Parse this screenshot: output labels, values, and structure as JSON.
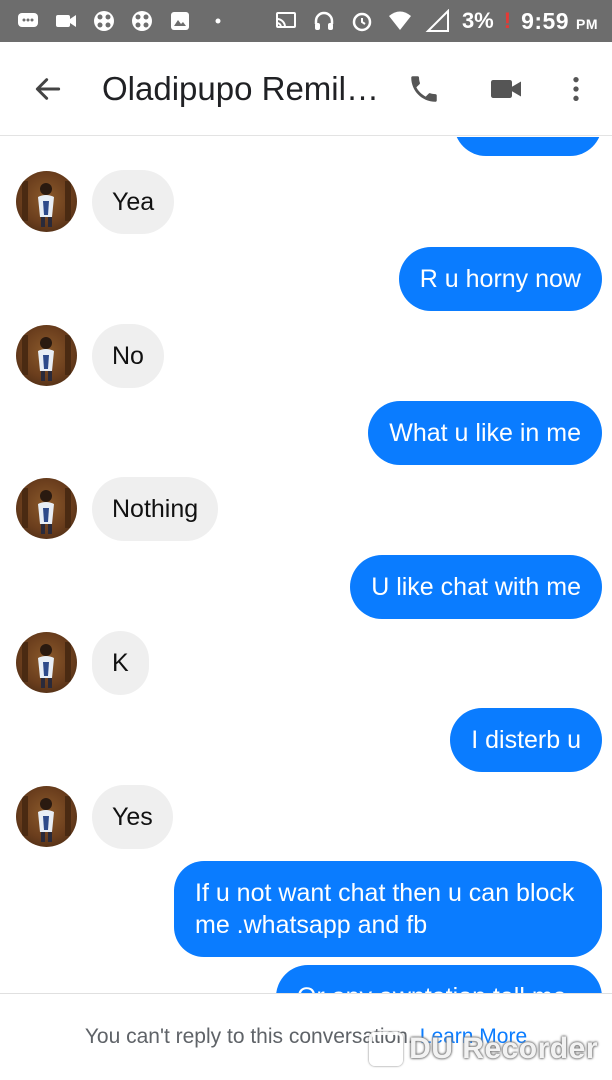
{
  "status_bar": {
    "battery": "3%",
    "battery_warning": "!",
    "time": "9:59",
    "ampm": "PM",
    "left_icons": [
      "chat-icon",
      "video-icon",
      "app-icon",
      "app-icon",
      "image-icon",
      "dot-icon"
    ],
    "right_icons": [
      "cast-icon",
      "headset-icon",
      "alarm-icon",
      "wifi-icon",
      "signal-icon"
    ]
  },
  "toolbar": {
    "title": "Oladipupo Remil…",
    "back_icon": "back-arrow-icon",
    "call_icon": "phone-icon",
    "video_icon": "video-camera-icon",
    "more_icon": "more-vert-icon"
  },
  "messages": [
    {
      "id": "m0",
      "dir": "out",
      "text": ""
    },
    {
      "id": "m1",
      "dir": "in",
      "text": "Yea"
    },
    {
      "id": "m2",
      "dir": "out",
      "text": "R u horny now"
    },
    {
      "id": "m3",
      "dir": "in",
      "text": "No"
    },
    {
      "id": "m4",
      "dir": "out",
      "text": "What u like in me"
    },
    {
      "id": "m5",
      "dir": "in",
      "text": "Nothing"
    },
    {
      "id": "m6",
      "dir": "out",
      "text": "U like chat with me"
    },
    {
      "id": "m7",
      "dir": "in",
      "text": "K"
    },
    {
      "id": "m8",
      "dir": "out",
      "text": "I disterb u"
    },
    {
      "id": "m9",
      "dir": "in",
      "text": "Yes"
    },
    {
      "id": "m10",
      "dir": "out",
      "text": "If u not want chat then u can block me .whatsapp and fb"
    },
    {
      "id": "m11",
      "dir": "out",
      "text": "Or any awntation tell me"
    }
  ],
  "footer": {
    "text": "You can't reply to this conversation.",
    "link": "Learn More"
  },
  "watermark": {
    "text": "DU Recorder"
  },
  "colors": {
    "accent": "#0a7cff",
    "incoming_bubble": "#efefef",
    "status_bar": "#6d6d6d"
  }
}
